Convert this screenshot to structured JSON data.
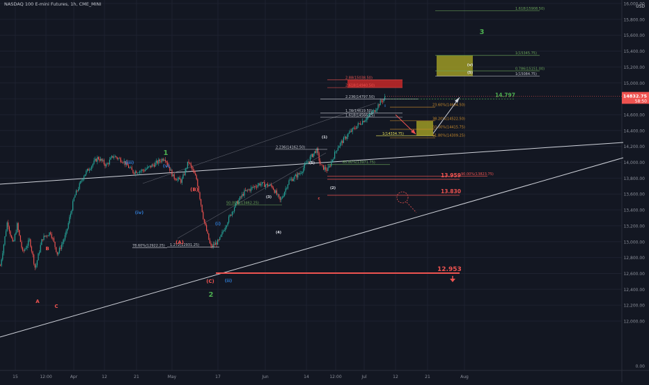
{
  "header": {
    "symbol": "NASDAQ 100 E-mini Futures, 1h, CME_MINI"
  },
  "axis": {
    "currency": "USD",
    "current_price": "14832.75",
    "countdown": "58:50"
  },
  "colors": {
    "background": "#131722",
    "up": "#26a69a",
    "down": "#ef5350",
    "wave_blue": "#2f7bd3",
    "wave_green": "#4caf50",
    "wave_red": "#ef5350",
    "olive_box": "#9e9a24",
    "fib_orange": "#c98b2c",
    "fib_green": "#6aa55a"
  },
  "chart_data": {
    "type": "candlestick",
    "x_ticks": [
      "15",
      "12:00",
      "Apr",
      "12",
      "21",
      "May",
      "17",
      "Jun",
      "14",
      "12:00",
      "Jul",
      "12",
      "21",
      "Aug"
    ],
    "y_ticks": [
      "16,000.00",
      "15,800.00",
      "15,600.00",
      "15,400.00",
      "15,200.00",
      "15,000.00",
      "14,800.00",
      "14,600.00",
      "14,400.00",
      "14,200.00",
      "14,000.00",
      "13,800.00",
      "13,600.00",
      "13,400.00",
      "13,200.00",
      "13,000.00",
      "12,800.00",
      "12,600.00",
      "12,400.00",
      "12,200.00",
      "12,000.00",
      "0.00"
    ],
    "ylim": [
      12000,
      16000
    ],
    "candle_keypoints": [
      [
        0,
        12700
      ],
      [
        10,
        13260
      ],
      [
        18,
        12960
      ],
      [
        24,
        13210
      ],
      [
        32,
        12860
      ],
      [
        42,
        13020
      ],
      [
        50,
        12660
      ],
      [
        60,
        13040
      ],
      [
        72,
        13120
      ],
      [
        82,
        12840
      ],
      [
        94,
        13090
      ],
      [
        106,
        13560
      ],
      [
        120,
        13840
      ],
      [
        140,
        14060
      ],
      [
        152,
        13960
      ],
      [
        162,
        14080
      ],
      [
        176,
        14020
      ],
      [
        190,
        13880
      ],
      [
        206,
        13900
      ],
      [
        222,
        13980
      ],
      [
        236,
        14060
      ],
      [
        248,
        13820
      ],
      [
        260,
        13760
      ],
      [
        270,
        14010
      ],
      [
        282,
        13780
      ],
      [
        292,
        13270
      ],
      [
        302,
        12930
      ],
      [
        314,
        13010
      ],
      [
        324,
        13220
      ],
      [
        336,
        13440
      ],
      [
        350,
        13620
      ],
      [
        372,
        13730
      ],
      [
        390,
        13700
      ],
      [
        402,
        13510
      ],
      [
        414,
        13760
      ],
      [
        430,
        13860
      ],
      [
        446,
        14070
      ],
      [
        454,
        14160
      ],
      [
        460,
        13950
      ],
      [
        470,
        13900
      ],
      [
        484,
        14190
      ],
      [
        500,
        14360
      ],
      [
        516,
        14490
      ],
      [
        526,
        14560
      ],
      [
        536,
        14640
      ],
      [
        544,
        14740
      ],
      [
        553,
        14820
      ]
    ],
    "series_levels": [
      {
        "label": "14.797",
        "color": "#4caf50"
      },
      {
        "label": "13.959",
        "color": "#ef5350"
      },
      {
        "label": "13.830",
        "color": "#ef5350"
      },
      {
        "label": "12.953",
        "color": "#ef5350"
      }
    ],
    "fib_labels": [
      {
        "text": "1.618(15908.50)",
        "color": "#6aa55a",
        "price": 15908.5
      },
      {
        "text": "1(15345.75)",
        "color": "#6aa55a",
        "price": 15345.75
      },
      {
        "text": "0.786(15151.00)",
        "color": "#6aa55a",
        "price": 15151
      },
      {
        "text": "1(15084.75)",
        "color": "#c5c8d0",
        "price": 15084.75
      },
      {
        "text": "2.88(15038.50)",
        "color": "#ef5350",
        "price": 15038.5
      },
      {
        "text": "2.618(14940.50)",
        "color": "#ef5350",
        "price": 14940.5
      },
      {
        "text": "2.236(14797.50)",
        "color": "#c5c8d0",
        "price": 14797.5
      },
      {
        "text": "23.60%(14694.50)",
        "color": "#c98b2c",
        "price": 14694.5
      },
      {
        "text": "1.76(14619.50)",
        "color": "#c5c8d0",
        "price": 14619.5
      },
      {
        "text": "1.618(14566.25)",
        "color": "#c5c8d0",
        "price": 14566.25
      },
      {
        "text": "38.20%(14522.50)",
        "color": "#c98b2c",
        "price": 14522.5
      },
      {
        "text": "50.00%(14415.75)",
        "color": "#c98b2c",
        "price": 14415.75
      },
      {
        "text": "1(14334.75)",
        "color": "#e8e35a",
        "price": 14334.75
      },
      {
        "text": "61.80%(14309.25)",
        "color": "#c98b2c",
        "price": 14309.25
      },
      {
        "text": "2.236(14162.50)",
        "color": "#c5c8d0",
        "price": 14162.5
      },
      {
        "text": "65.80%(13971.75)",
        "color": "#6aa55a",
        "price": 13971.75
      },
      {
        "text": "50.00%(13462.25)",
        "color": "#6aa55a",
        "price": 13462.25
      },
      {
        "text": "90.00%(13823.75)",
        "color": "#ef5350",
        "price": 13823.75
      },
      {
        "text": "78.60%(12922.25)",
        "color": "#c5c8d0",
        "price": 12922.25
      },
      {
        "text": "1.272(12931.25)",
        "color": "#c5c8d0",
        "price": 12931.25
      }
    ],
    "wave_labels": [
      {
        "text": "1",
        "color": "#4caf50"
      },
      {
        "text": "2",
        "color": "#4caf50"
      },
      {
        "text": "3",
        "color": "#4caf50"
      },
      {
        "text": "A",
        "color": "#ef5350"
      },
      {
        "text": "B",
        "color": "#ef5350"
      },
      {
        "text": "C",
        "color": "#ef5350"
      },
      {
        "text": "(A)",
        "color": "#ef5350"
      },
      {
        "text": "(B)",
        "color": "#ef5350"
      },
      {
        "text": "(C)",
        "color": "#ef5350"
      },
      {
        "text": "(i)",
        "color": "#2f7bd3"
      },
      {
        "text": "(ii)",
        "color": "#2f7bd3"
      },
      {
        "text": "(iii)",
        "color": "#2f7bd3"
      },
      {
        "text": "(iv)",
        "color": "#2f7bd3"
      },
      {
        "text": "(v)",
        "color": "#2f7bd3"
      },
      {
        "text": "(1)",
        "color": "#e0e3eb"
      },
      {
        "text": "(2)",
        "color": "#e0e3eb"
      },
      {
        "text": "(3)",
        "color": "#e0e3eb"
      },
      {
        "text": "(4)",
        "color": "#e0e3eb"
      },
      {
        "text": "(5)",
        "color": "#e0e3eb"
      },
      {
        "text": "i",
        "color": "#2f7bd3"
      },
      {
        "text": "c",
        "color": "#ef5350"
      },
      {
        "text": "(v)",
        "color": "#e0e3eb"
      },
      {
        "text": "(5)",
        "color": "#e0e3eb"
      }
    ]
  }
}
